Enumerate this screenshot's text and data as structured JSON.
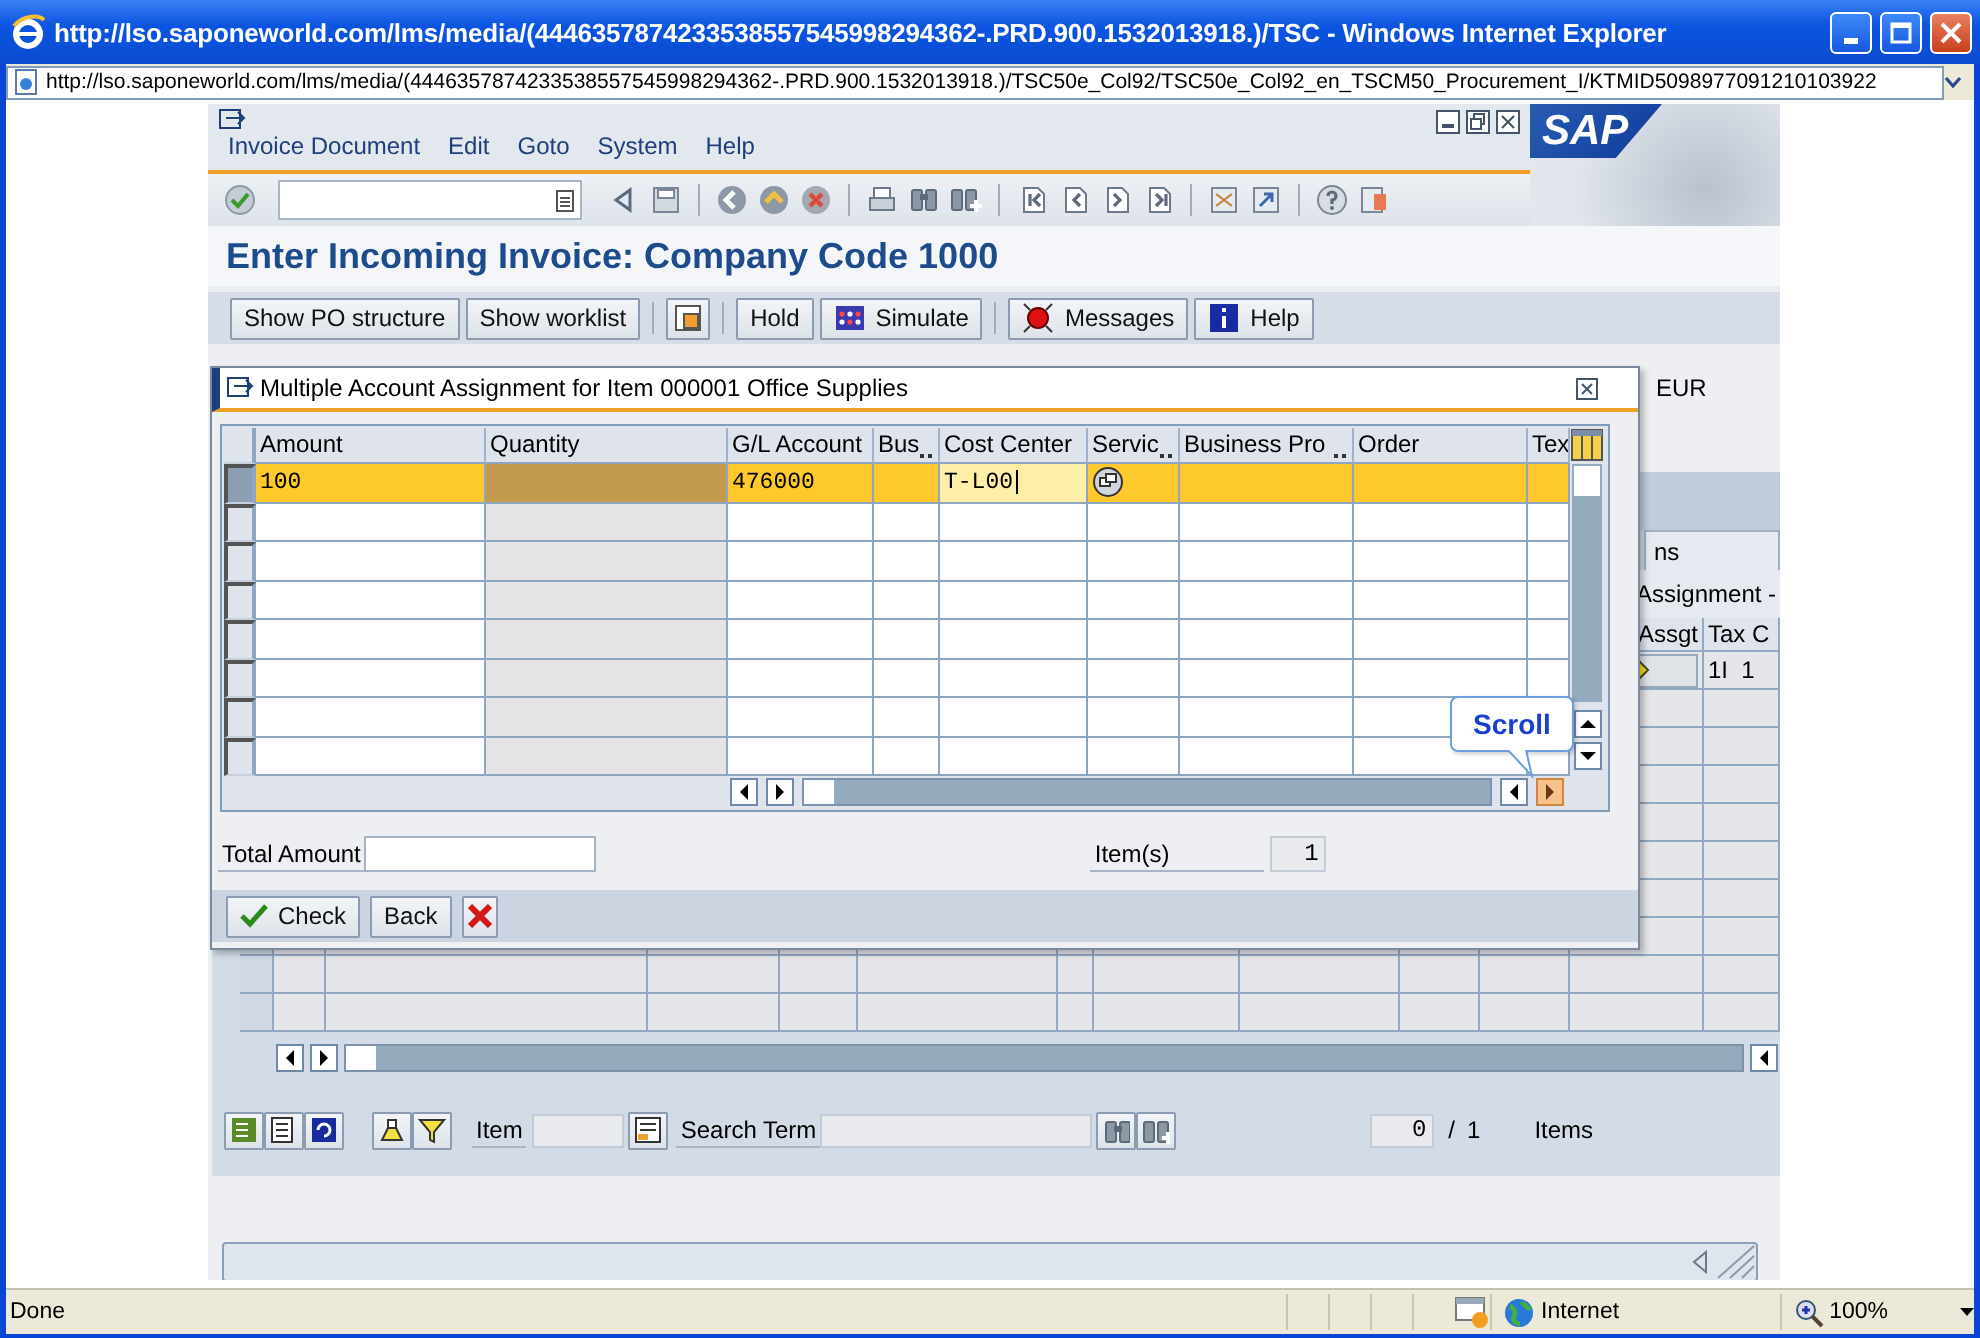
{
  "browser": {
    "title": "http://lso.saponeworld.com/lms/media/(4446357874233538557545998294362-.PRD.900.1532013918.)/TSC - Windows Internet Explorer",
    "address": "http://lso.saponeworld.com/lms/media/(4446357874233538557545998294362-.PRD.900.1532013918.)/TSC50e_Col92/TSC50e_Col92_en_TSCM50_Procurement_I/KTMID5098977091210103922",
    "status": "Done",
    "zone": "Internet",
    "zoom": "100%"
  },
  "sap": {
    "menu": [
      "Invoice Document",
      "Edit",
      "Goto",
      "System",
      "Help"
    ],
    "logo": "SAP",
    "title": "Enter Incoming Invoice: Company Code 1000",
    "app_toolbar": [
      [
        {
          "kind": "text",
          "label": "Show PO structure"
        },
        {
          "kind": "text",
          "label": "Show worklist"
        }
      ],
      [
        {
          "kind": "icon"
        }
      ],
      [
        {
          "kind": "text",
          "label": "Hold"
        },
        {
          "kind": "icon_text",
          "label": "Simulate"
        }
      ],
      [
        {
          "kind": "icon_text",
          "label": "Messages"
        },
        {
          "kind": "icon_text",
          "label": "Help"
        }
      ]
    ],
    "background": {
      "currency": "EUR",
      "tab": "ns",
      "section": "Assignment -",
      "headers": [
        "Assgt",
        "Tax C"
      ],
      "row": [
        "1I  1"
      ]
    },
    "bottom_toolbar": {
      "item_label": "Item",
      "search_label": "Search Term",
      "counter": "0",
      "separator": "/",
      "total": "1",
      "items_label": "Items"
    }
  },
  "dialog": {
    "title": "Multiple Account Assignment for Item 000001 Office Supplies",
    "columns": [
      {
        "label": "Amount",
        "truncated": false,
        "disabled": false
      },
      {
        "label": "Quantity",
        "truncated": false,
        "disabled": true
      },
      {
        "label": "G/L Account",
        "truncated": false,
        "disabled": false
      },
      {
        "label": "Bus",
        "truncated": true,
        "disabled": false
      },
      {
        "label": "Cost Center",
        "truncated": false,
        "disabled": false
      },
      {
        "label": "Servic",
        "truncated": true,
        "disabled": false
      },
      {
        "label": "Business Pro",
        "truncated": true,
        "disabled": false
      },
      {
        "label": "Order",
        "truncated": false,
        "disabled": false
      },
      {
        "label": "Tex",
        "truncated": false,
        "disabled": false
      }
    ],
    "rows": [
      {
        "selected": true,
        "cells": [
          {
            "text": "100"
          },
          null,
          {
            "text": "476000"
          },
          null,
          {
            "text": "T-L00",
            "editing": true
          },
          {
            "kind": "help_button"
          },
          null,
          null,
          null
        ]
      }
    ],
    "total_label": "Total Amount",
    "items_label": "Item(s)",
    "items_value": "1",
    "buttons": [
      {
        "kind": "icon_text",
        "label": "Check"
      },
      {
        "kind": "text",
        "label": "Back"
      },
      {
        "kind": "icon"
      }
    ],
    "tooltip": "Scroll"
  }
}
